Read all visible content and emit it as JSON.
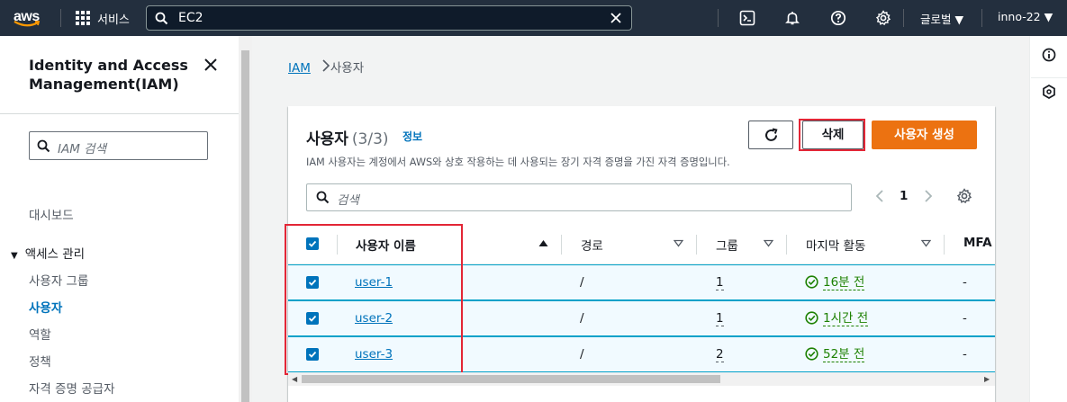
{
  "topnav": {
    "logo_text": "aws",
    "services_label": "서비스",
    "search_value": "EC2",
    "region_label": "글로벌 ▼",
    "account_label": "inno-22 ▼"
  },
  "sidebar": {
    "title": "Identity and Access Management(IAM)",
    "search_placeholder": "IAM 검색",
    "dashboard": "대시보드",
    "section_label": "액세스 관리",
    "items": [
      {
        "label": "사용자 그룹"
      },
      {
        "label": "사용자"
      },
      {
        "label": "역할"
      },
      {
        "label": "정책"
      },
      {
        "label": "자격 증명 공급자"
      }
    ]
  },
  "breadcrumb": {
    "root": "IAM",
    "current": "사용자"
  },
  "users_panel": {
    "title": "사용자",
    "count": "(3/3)",
    "info_link": "정보",
    "description": "IAM 사용자는 계정에서 AWS와 상호 작용하는 데 사용되는 장기 자격 증명을 가진 자격 증명입니다.",
    "delete_label": "삭제",
    "create_label": "사용자 생성",
    "filter_placeholder": "검색",
    "page_number": "1",
    "columns": {
      "username": "사용자 이름",
      "path": "경로",
      "groups": "그룹",
      "last_activity": "마지막 활동",
      "mfa": "MFA"
    },
    "rows": [
      {
        "username": "user-1",
        "path": "/",
        "groups": "1",
        "last_activity": "16분 전",
        "mfa": "-"
      },
      {
        "username": "user-2",
        "path": "/",
        "groups": "1",
        "last_activity": "1시간 전",
        "mfa": "-"
      },
      {
        "username": "user-3",
        "path": "/",
        "groups": "2",
        "last_activity": "52분 전",
        "mfa": "-"
      }
    ]
  },
  "colors": {
    "topnav_bg": "#232f3e",
    "link": "#0073bb",
    "primary_button": "#ec7211",
    "highlight_box": "#e32636",
    "success": "#1d8102"
  }
}
